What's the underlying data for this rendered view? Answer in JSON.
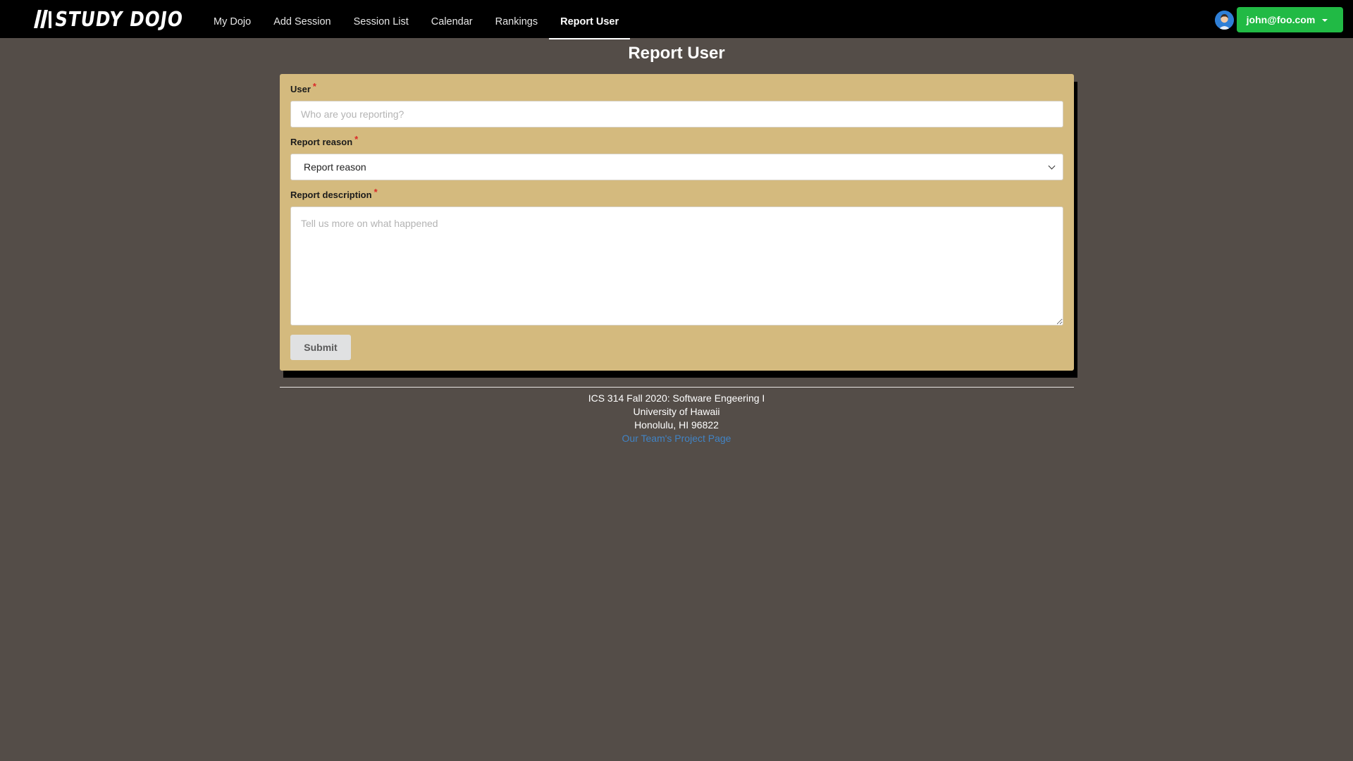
{
  "brand": {
    "logo_text": "STUDY DOJO"
  },
  "nav": {
    "items": [
      {
        "label": "My Dojo"
      },
      {
        "label": "Add Session"
      },
      {
        "label": "Session List"
      },
      {
        "label": "Calendar"
      },
      {
        "label": "Rankings"
      },
      {
        "label": "Report User",
        "active": true
      }
    ]
  },
  "user_menu": {
    "email": "john@foo.com"
  },
  "page": {
    "title": "Report User"
  },
  "form": {
    "user": {
      "label": "User",
      "required_mark": "*",
      "placeholder": "Who are you reporting?",
      "value": ""
    },
    "reason": {
      "label": "Report reason",
      "required_mark": "*",
      "selected": "Report reason"
    },
    "description": {
      "label": "Report description",
      "required_mark": "*",
      "placeholder": "Tell us more on what happened",
      "value": ""
    },
    "submit_label": "Submit"
  },
  "footer": {
    "line1": "ICS 314 Fall 2020: Software Engeering I",
    "line2": "University of Hawaii",
    "line3": "Honolulu, HI 96822",
    "link_text": "Our Team's Project Page"
  },
  "colors": {
    "background": "#544d48",
    "navbar": "#000000",
    "card": "#d4ba7e",
    "user_button": "#21ba45",
    "link": "#4183c4",
    "required": "#db2828"
  },
  "icons": [
    "study-dojo-logo",
    "user-avatar",
    "caret-down-icon",
    "chevron-down-icon"
  ]
}
